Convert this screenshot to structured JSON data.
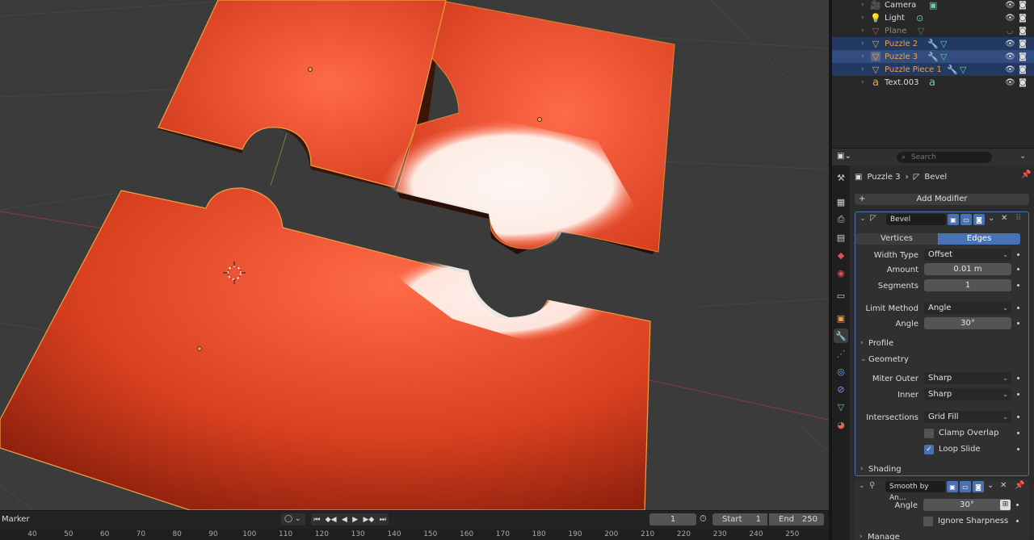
{
  "outliner": {
    "rows": [
      {
        "name": "Camera",
        "state": "normal"
      },
      {
        "name": "Light",
        "state": "normal"
      },
      {
        "name": "Plane",
        "state": "dim"
      },
      {
        "name": "Puzzle 2",
        "state": "selected"
      },
      {
        "name": "Puzzle 3",
        "state": "active"
      },
      {
        "name": "Puzzle Piece 1",
        "state": "selected"
      },
      {
        "name": "Text.003",
        "state": "normal"
      }
    ]
  },
  "properties": {
    "search_placeholder": "Search",
    "breadcrumb": {
      "object": "Puzzle 3",
      "modifier": "Bevel"
    },
    "add_modifier": "Add Modifier",
    "bevel": {
      "name": "Bevel",
      "affect_tabs": [
        "Vertices",
        "Edges"
      ],
      "affect_active": "Edges",
      "width_type_label": "Width Type",
      "width_type": "Offset",
      "amount_label": "Amount",
      "amount": "0.01 m",
      "segments_label": "Segments",
      "segments": "1",
      "limit_method_label": "Limit Method",
      "limit_method": "Angle",
      "angle_label": "Angle",
      "angle": "30°",
      "profile_label": "Profile",
      "geometry_label": "Geometry",
      "miter_outer_label": "Miter Outer",
      "miter_outer": "Sharp",
      "inner_label": "Inner",
      "inner": "Sharp",
      "intersections_label": "Intersections",
      "intersections": "Grid Fill",
      "clamp_overlap_label": "Clamp Overlap",
      "clamp_overlap": false,
      "loop_slide_label": "Loop Slide",
      "loop_slide": true,
      "shading_label": "Shading"
    },
    "smooth": {
      "name": "Smooth by An...",
      "angle_label": "Angle",
      "angle": "30°",
      "ignore_sharpness_label": "Ignore Sharpness",
      "ignore_sharpness": false,
      "manage_label": "Manage"
    }
  },
  "timeline": {
    "marker_label": "Marker",
    "current_frame": "1",
    "start_label": "Start",
    "start": "1",
    "end_label": "End",
    "end": "250",
    "ruler": [
      "40",
      "50",
      "60",
      "70",
      "80",
      "90",
      "100",
      "110",
      "120",
      "130",
      "140",
      "150",
      "160",
      "170",
      "180",
      "190",
      "200",
      "210",
      "220",
      "230",
      "240",
      "250"
    ]
  },
  "colors": {
    "accent": "#4772b3",
    "selection_orange": "#f0a040",
    "object_orange": "#ee5030",
    "modifier_blue": "#6aa5ff",
    "data_green": "#5fd1a4"
  }
}
